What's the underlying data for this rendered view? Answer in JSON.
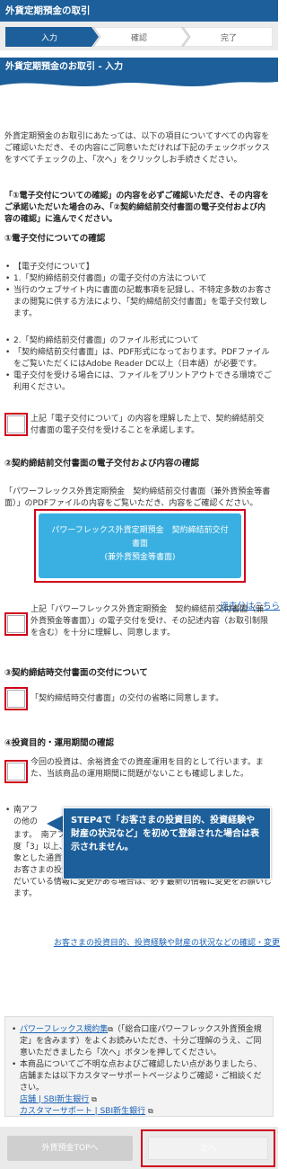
{
  "header": {
    "title": "外貨定期預金の取引"
  },
  "steps": [
    {
      "label": "入力",
      "state": "active"
    },
    {
      "label": "確認",
      "state": "inactive"
    },
    {
      "label": "完了",
      "state": "inactive"
    }
  ],
  "section_title": "外貨定期預金のお取引 - 入力",
  "intro": "外貨定期預金のお取引にあたっては、以下の項目についてすべての内容をご確認いただき、その内容にご同意いただければ下記のチェックボックスをすべてチェックの上、「次へ」をクリックしお手続きください。",
  "notice": "「①電子交付についての確認」の内容を必ずご確認いただき、その内容をご承諾いただいた場合のみ、「②契約締結前交付書面の電子交付および内容の確認」に進んでください。",
  "s1": {
    "title": "①電子交付についての確認",
    "group1": [
      "【電子交付について】",
      "1.「契約締結前交付書面」の電子交付の方法について",
      "当行のウェブサイト内に書面の記載事項を記録し、不特定多数のお客さまの閲覧に供する方法により、「契約締結前交付書面」を電子交付致します。"
    ],
    "group2": [
      "2.「契約締結前交付書面」のファイル形式について",
      "「契約締結前交付書面」は、PDF形式になっております。PDFファイルをご覧いただくにはAdobe Reader DC以上（日本語）が必要です。",
      "電子交付を受ける場合には、ファイルをプリントアウトできる環境でご利用ください。"
    ],
    "checkbox_label": "上記「電子交付について」の内容を理解した上で、契約締結前交付書面の電子交付を受けることを承諾します。"
  },
  "s2": {
    "title": "②契約締結前交付書面の電子交付および内容の確認",
    "desc": "「パワーフレックス外貨定期預金　契約締結前交付書面（兼外貨預金等書面）」のPDFファイルの内容をご覧いただき、内容をご確認ください。",
    "pdf_button": {
      "line1": "パワーフレックス外貨定期預金　契約締結前交付",
      "line2": "書面",
      "line3": "(兼外貨預金等書面)"
    },
    "past_link": "過去分はこちら",
    "checkbox_label": "上記「パワーフレックス外貨定期預金　契約締結前交付書面（兼外貨預金等書面）」の電子交付を受け、その記述内容（お取引制限を含む）を十分に理解し、同意します。"
  },
  "s3": {
    "title": "③契約締結時交付書面の交付について",
    "checkbox_label": "「契約締結時交付書面」の交付の省略に同意します。"
  },
  "s4": {
    "title": "④投資目的・運用期間の確認",
    "checkbox_label": "今回の投資は、余裕資金での資産運用を目的として行います。また、当該商品の運用期間に問題がないことも確認しました。",
    "note_line1": "南アフ",
    "note_line2": "の他の",
    "note_rest": "ます。　南アフリカ・ランド、人民元、ブラジル・レアルはリスク許容度「3」以上、トルコ・リラはリスク許容度「5」以上のお客さまを対象とした通貨となります。",
    "note_para2": "お客さまの投資目的、投資経験や財産の状況などについて、ご登録いただいている情報に変更がある場合は、必ず最新の情報に変更をお願いします。",
    "change_link": "お客さまの投資目的、投資経験や財産の状況などの確認・変更"
  },
  "tooltip": "STEP4で「お客さまの投資目的、投資経験や財産の状況など」を初めて登録された場合は表示されません。",
  "info": {
    "terms_link": "パワーフレックス規約集",
    "terms_text": "（「総合口座パワーフレックス外貨預金規定」を含みます）をよくお読みいただき、十分ご理解のうえ、ご同意いただきましたら「次へ」ボタンを押してください。",
    "contact_text": "本商品についてご不明な点およびご確認したい点がありましたら、店舗または以下カスタマーサポートページよりご確認・ご相談ください。",
    "link_store": "店舗 | SBI新生銀行",
    "link_support": "カスタマーサポート | SBI新生銀行"
  },
  "footer": {
    "back_label": "外貨預金TOPへ",
    "next_label": "次へ"
  },
  "colors": {
    "primary": "#1d5f9a",
    "accent_button": "#3ab0e2",
    "highlight": "#d0021b",
    "link": "#1a62b6"
  }
}
